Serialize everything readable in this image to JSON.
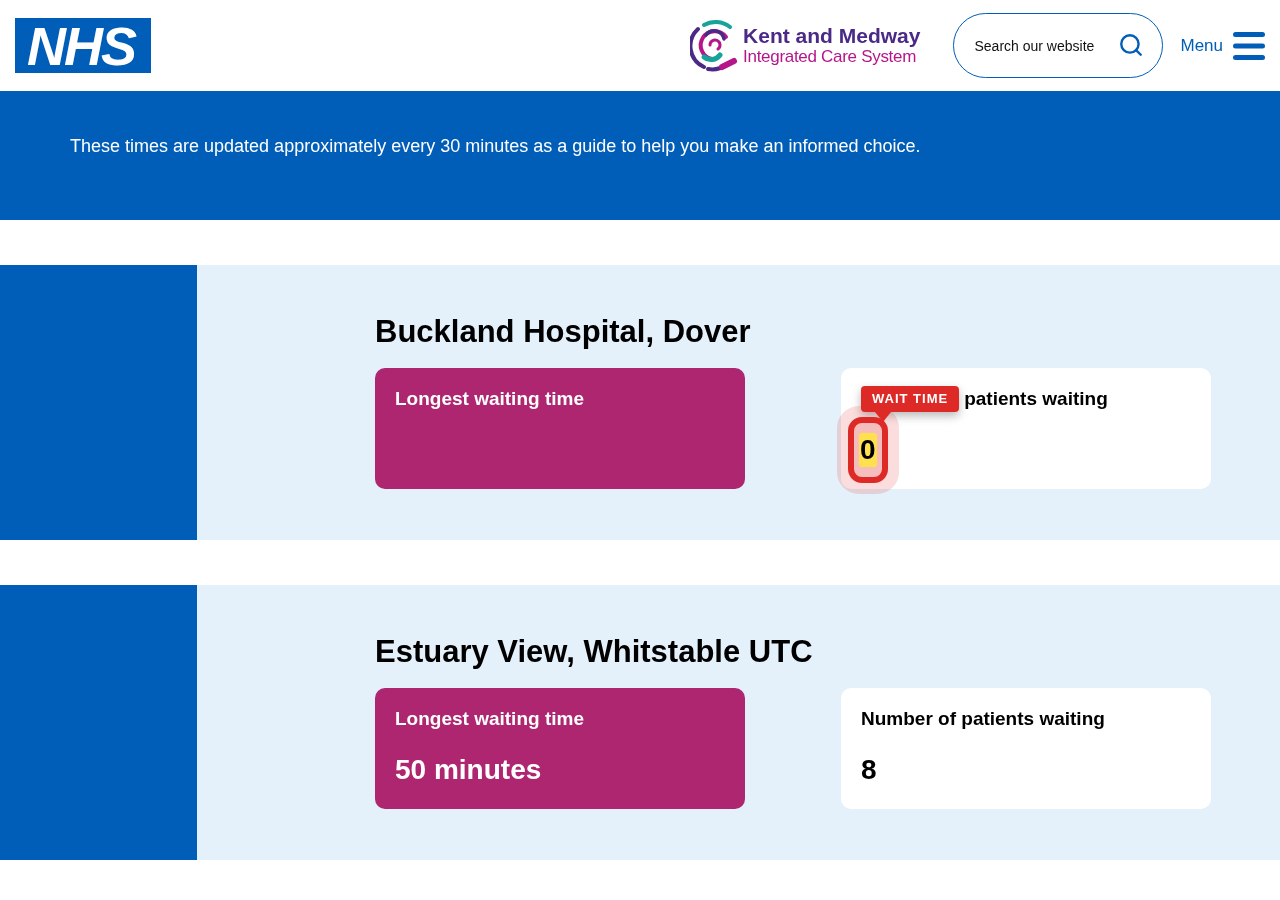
{
  "header": {
    "logo": "NHS",
    "partner_logo": {
      "title": "Kent and Medway",
      "subtitle": "Integrated Care System"
    },
    "search": {
      "placeholder": "Search our website"
    },
    "menu": {
      "label": "Menu"
    }
  },
  "banner": {
    "text": "These times are updated approximately every 30 minutes as a guide to help you make an informed choice."
  },
  "sections": [
    {
      "name": "Buckland Hospital, Dover",
      "waiting_card": {
        "label": "Longest waiting time"
      },
      "patients_card": {
        "label": "patients waiting",
        "value": "0",
        "annotation": {
          "label": "WAIT TIME"
        }
      }
    },
    {
      "name": "Estuary View, Whitstable UTC",
      "waiting_card": {
        "label": "Longest waiting time",
        "value": "50 minutes"
      },
      "patients_card": {
        "label": "Number of patients waiting",
        "value": "8"
      }
    }
  ]
}
